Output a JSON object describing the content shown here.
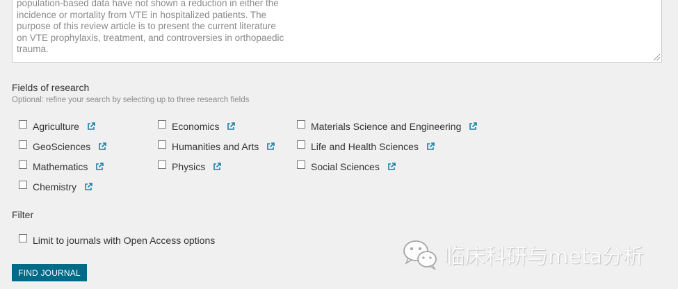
{
  "abstract": {
    "text": "population-based data have not shown a reduction in either the\nincidence or mortality from VTE in hospitalized patients. The\npurpose of this review article is to present the current literature\non VTE prophylaxis, treatment, and controversies in orthopaedic\ntrauma."
  },
  "fields": {
    "title": "Fields of research",
    "hint": "Optional: refine your search by selecting up to three research fields",
    "items": [
      {
        "label": "Agriculture",
        "checked": false,
        "icon": "external-link-icon"
      },
      {
        "label": "Economics",
        "checked": false,
        "icon": "external-link-icon"
      },
      {
        "label": "Materials Science and Engineering",
        "checked": false,
        "icon": "external-link-icon"
      },
      {
        "label": "GeoSciences",
        "checked": false,
        "icon": "external-link-icon"
      },
      {
        "label": "Humanities and Arts",
        "checked": false,
        "icon": "external-link-icon"
      },
      {
        "label": "Life and Health Sciences",
        "checked": false,
        "icon": "external-link-icon"
      },
      {
        "label": "Mathematics",
        "checked": false,
        "icon": "external-link-icon"
      },
      {
        "label": "Physics",
        "checked": false,
        "icon": "external-link-icon"
      },
      {
        "label": "Social Sciences",
        "checked": false,
        "icon": "external-link-icon"
      },
      {
        "label": "Chemistry",
        "checked": false,
        "icon": "external-link-icon"
      }
    ]
  },
  "filter": {
    "title": "Filter",
    "open_access_label": "Limit to journals with Open Access options",
    "open_access_checked": false
  },
  "button": {
    "label": "FIND JOURNAL"
  },
  "watermark": {
    "text": "临床科研与meta分析"
  },
  "colors": {
    "accent": "#006a87",
    "link_icon": "#1a7fa8"
  }
}
